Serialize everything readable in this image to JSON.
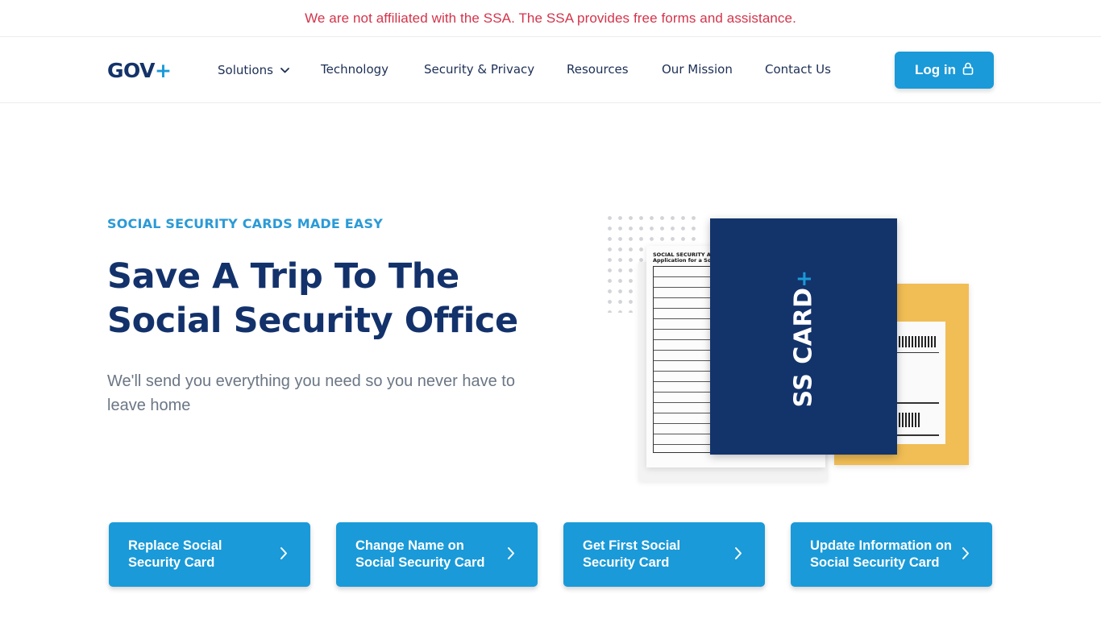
{
  "banner": {
    "text": "We are not affiliated with the SSA. The SSA provides free forms and assistance.",
    "color": "#d3344a"
  },
  "nav": {
    "logo_text": "GOV",
    "logo_plus": "+",
    "items": [
      {
        "label": "Solutions",
        "has_dropdown": true
      },
      {
        "label": "Technology"
      },
      {
        "label": "Security & Privacy"
      },
      {
        "label": "Resources"
      },
      {
        "label": "Our Mission"
      },
      {
        "label": "Contact Us"
      }
    ],
    "login_label": "Log in",
    "login_icon": "lock-icon"
  },
  "hero": {
    "eyebrow": "SOCIAL SECURITY CARDS MADE EASY",
    "headline_line1": "Save A Trip To The",
    "headline_line2": "Social Security Office",
    "subtext": "We'll send you everything you need so you never have to leave home",
    "illustration": {
      "card_text": "SS CARD",
      "card_plus": "+",
      "form_title_line1": "SOCIAL SECURITY ADMI",
      "form_title_line2": "Application for a Social"
    }
  },
  "ctas": [
    {
      "label": "Replace Social Security Card",
      "icon": "chevron-right-icon"
    },
    {
      "label": "Change Name on Social Security Card",
      "icon": "chevron-right-icon"
    },
    {
      "label": "Get First Social Security Card",
      "icon": "chevron-right-icon"
    },
    {
      "label": "Update Information on Social Security Card",
      "icon": "chevron-right-icon"
    }
  ],
  "colors": {
    "brand_navy": "#13326b",
    "brand_blue": "#1a9ad8",
    "envelope_yellow": "#f1bd55"
  }
}
